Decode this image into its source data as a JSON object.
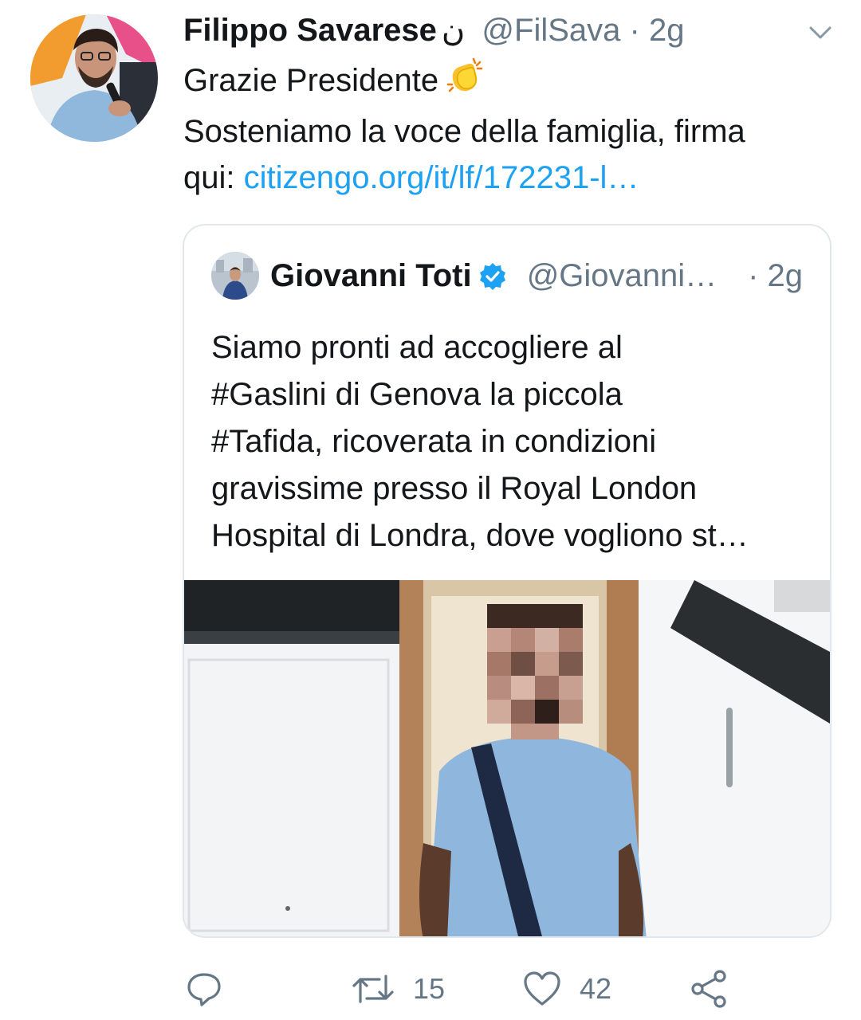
{
  "tweet": {
    "author_name": "Filippo Savarese",
    "author_glyph": "ن",
    "handle": "@FilSava",
    "separator": "·",
    "time": "2g",
    "text_lines": [
      "Grazie Presidente",
      "Sosteniamo la voce della famiglia, firma"
    ],
    "link_prefix": "qui: ",
    "link_text": "citizengo.org/it/lf/172231-l…",
    "emoji": "clapping-hands"
  },
  "quoted": {
    "author_name": "Giovanni Toti",
    "verified": true,
    "handle": "@Giovanni…",
    "time": "· 2g",
    "text_lines": [
      "Siamo pronti ad accogliere al",
      "#Gaslini di Genova la piccola",
      "#Tafida, ricoverata in condizioni",
      "gravissime presso il Royal London",
      "Hospital di Londra, dove vogliono st…"
    ],
    "media": "photo of a child in a blue shirt (face pixelated) in a kitchen"
  },
  "actions": {
    "reply_count": "",
    "retweet_count": "15",
    "like_count": "42"
  },
  "colors": {
    "link": "#1da1f2",
    "secondary_text": "#657786",
    "verified": "#1da1f2",
    "border": "#e1e8ed"
  },
  "icons": [
    "caret-down-icon",
    "verified-badge-icon",
    "reply-icon",
    "retweet-icon",
    "like-icon",
    "share-icon"
  ]
}
